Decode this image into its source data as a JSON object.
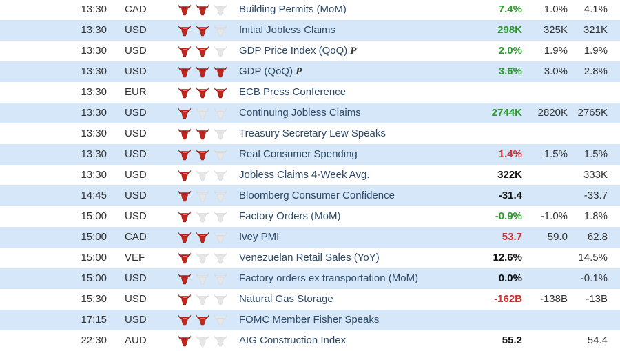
{
  "colors": {
    "bull_on": "#c0281e",
    "bull_off": "#e6e6e6",
    "row_alt": "#d5e7f8",
    "positive": "#2a9a2a",
    "negative": "#d03030"
  },
  "icons": {
    "importance": "bull-head-icon"
  },
  "rows": [
    {
      "time": "13:30",
      "currency": "CAD",
      "importance": 2,
      "event": "Building Permits (MoM)",
      "prelim": "",
      "actual": "7.4%",
      "actual_color": "green",
      "forecast": "1.0%",
      "previous": "4.1%"
    },
    {
      "time": "13:30",
      "currency": "USD",
      "importance": 2,
      "event": "Initial Jobless Claims",
      "prelim": "",
      "actual": "298K",
      "actual_color": "green",
      "forecast": "325K",
      "previous": "321K"
    },
    {
      "time": "13:30",
      "currency": "USD",
      "importance": 2,
      "event": "GDP Price Index (QoQ)",
      "prelim": "P",
      "actual": "2.0%",
      "actual_color": "green",
      "forecast": "1.9%",
      "previous": "1.9%"
    },
    {
      "time": "13:30",
      "currency": "USD",
      "importance": 3,
      "event": "GDP (QoQ)",
      "prelim": "P",
      "actual": "3.6%",
      "actual_color": "green",
      "forecast": "3.0%",
      "previous": "2.8%"
    },
    {
      "time": "13:30",
      "currency": "EUR",
      "importance": 3,
      "event": "ECB Press Conference",
      "prelim": "",
      "actual": "",
      "actual_color": "black",
      "forecast": "",
      "previous": ""
    },
    {
      "time": "13:30",
      "currency": "USD",
      "importance": 1,
      "event": "Continuing Jobless Claims",
      "prelim": "",
      "actual": "2744K",
      "actual_color": "green",
      "forecast": "2820K",
      "previous": "2765K"
    },
    {
      "time": "13:30",
      "currency": "USD",
      "importance": 2,
      "event": "Treasury Secretary Lew Speaks",
      "prelim": "",
      "actual": "",
      "actual_color": "black",
      "forecast": "",
      "previous": ""
    },
    {
      "time": "13:30",
      "currency": "USD",
      "importance": 2,
      "event": "Real Consumer Spending",
      "prelim": "",
      "actual": "1.4%",
      "actual_color": "red",
      "forecast": "1.5%",
      "previous": "1.5%"
    },
    {
      "time": "13:30",
      "currency": "USD",
      "importance": 1,
      "event": "Jobless Claims 4-Week Avg.",
      "prelim": "",
      "actual": "322K",
      "actual_color": "black",
      "forecast": "",
      "previous": "333K"
    },
    {
      "time": "14:45",
      "currency": "USD",
      "importance": 1,
      "event": "Bloomberg Consumer Confidence",
      "prelim": "",
      "actual": "-31.4",
      "actual_color": "black",
      "forecast": "",
      "previous": "-33.7"
    },
    {
      "time": "15:00",
      "currency": "USD",
      "importance": 1,
      "event": "Factory Orders (MoM)",
      "prelim": "",
      "actual": "-0.9%",
      "actual_color": "green",
      "forecast": "-1.0%",
      "previous": "1.8%"
    },
    {
      "time": "15:00",
      "currency": "CAD",
      "importance": 2,
      "event": "Ivey PMI",
      "prelim": "",
      "actual": "53.7",
      "actual_color": "red",
      "forecast": "59.0",
      "previous": "62.8"
    },
    {
      "time": "15:00",
      "currency": "VEF",
      "importance": 1,
      "event": "Venezuelan Retail Sales (YoY)",
      "prelim": "",
      "actual": "12.6%",
      "actual_color": "black",
      "forecast": "",
      "previous": "14.5%"
    },
    {
      "time": "15:00",
      "currency": "USD",
      "importance": 1,
      "event": "Factory orders ex transportation (MoM)",
      "prelim": "",
      "actual": "0.0%",
      "actual_color": "black",
      "forecast": "",
      "previous": "-0.1%"
    },
    {
      "time": "15:30",
      "currency": "USD",
      "importance": 1,
      "event": "Natural Gas Storage",
      "prelim": "",
      "actual": "-162B",
      "actual_color": "red",
      "forecast": "-138B",
      "previous": "-13B"
    },
    {
      "time": "17:15",
      "currency": "USD",
      "importance": 2,
      "event": "FOMC Member Fisher Speaks",
      "prelim": "",
      "actual": "",
      "actual_color": "black",
      "forecast": "",
      "previous": ""
    },
    {
      "time": "22:30",
      "currency": "AUD",
      "importance": 1,
      "event": "AIG Construction Index",
      "prelim": "",
      "actual": "55.2",
      "actual_color": "black",
      "forecast": "",
      "previous": "54.4"
    }
  ]
}
